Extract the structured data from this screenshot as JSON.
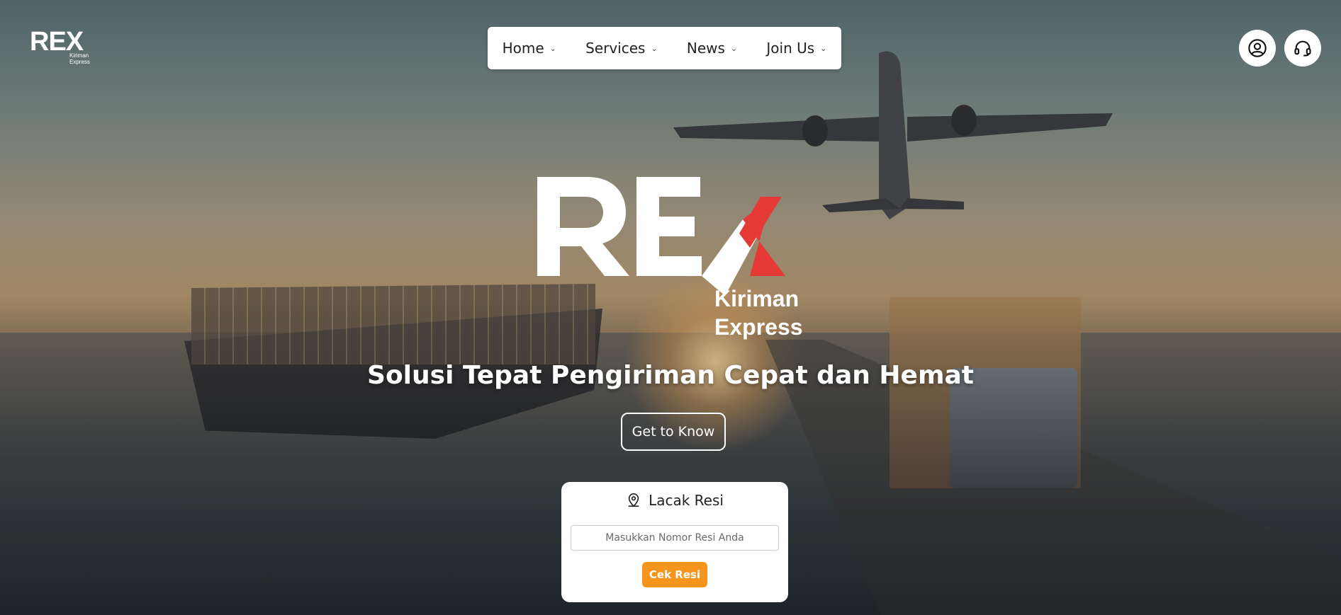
{
  "brand": {
    "logo_text": "REX",
    "logo_sub_line1": "Kiriman",
    "logo_sub_line2": "Express",
    "accent_color": "#e53935"
  },
  "nav": {
    "items": [
      {
        "label": "Home"
      },
      {
        "label": "Services"
      },
      {
        "label": "News"
      },
      {
        "label": "Join Us"
      }
    ],
    "chevron_icon": "chevron-down-icon"
  },
  "header_actions": {
    "account_icon": "user-icon",
    "support_icon": "headset-icon"
  },
  "hero": {
    "headline": "Solusi Tepat Pengiriman Cepat dan Hemat",
    "cta_label": "Get to Know"
  },
  "tracking": {
    "title": "Lacak Resi",
    "title_icon": "location-pin-icon",
    "input_placeholder": "Masukkan Nomor Resi Anda",
    "input_value": "",
    "submit_label": "Cek Resi",
    "submit_color": "#f7941d"
  }
}
